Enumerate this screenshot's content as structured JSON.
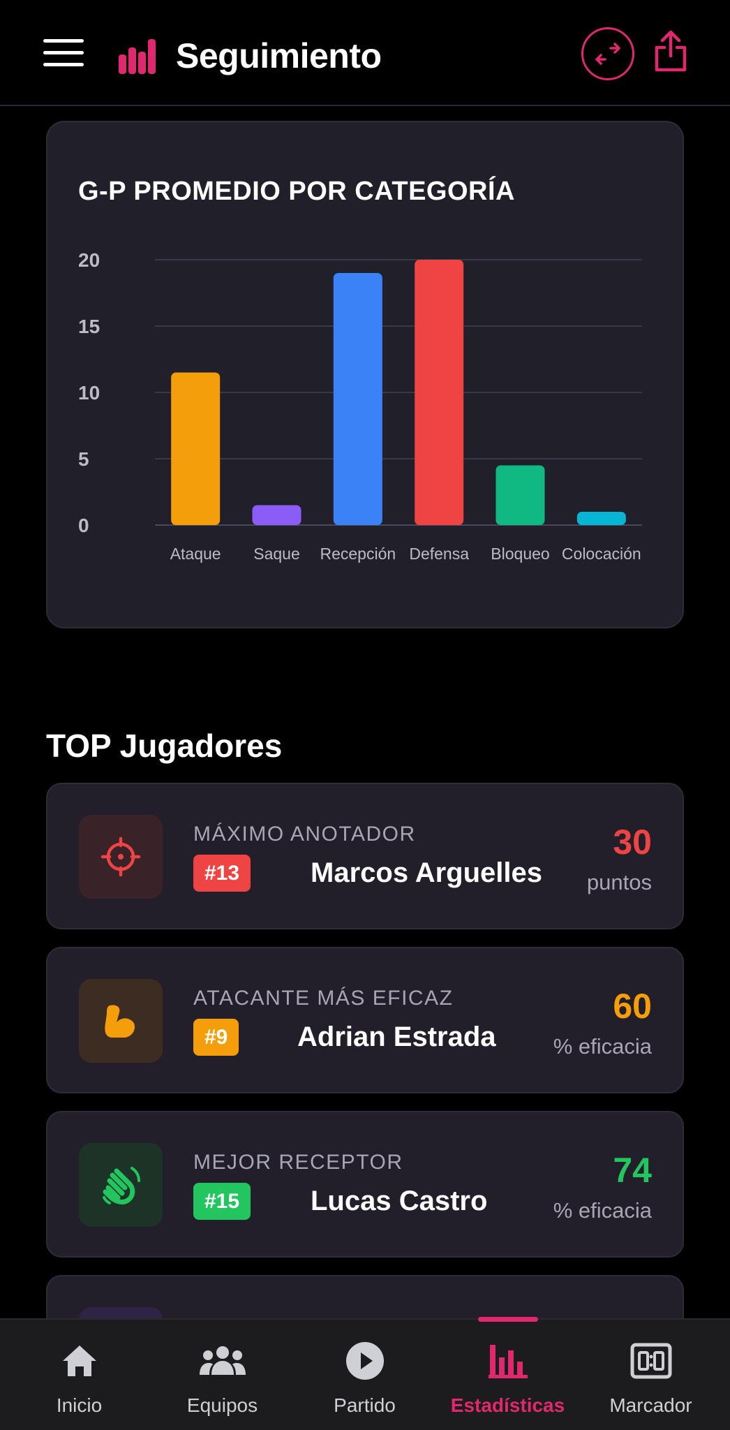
{
  "header": {
    "title": "Seguimiento",
    "accent": "#e0286e"
  },
  "chart_data": {
    "type": "bar",
    "title": "G-P PROMEDIO POR CATEGORÍA",
    "categories": [
      "Ataque",
      "Saque",
      "Recepción",
      "Defensa",
      "Bloqueo",
      "Colocación"
    ],
    "values": [
      11.5,
      1.5,
      19,
      20,
      4.5,
      1
    ],
    "colors": [
      "#f59e0b",
      "#8b5cf6",
      "#3b82f6",
      "#ef4444",
      "#10b981",
      "#06b6d4"
    ],
    "yticks": [
      0,
      5,
      10,
      15,
      20
    ],
    "ylim": [
      0,
      20
    ],
    "grid": true
  },
  "top_players": {
    "title": "TOP Jugadores",
    "items": [
      {
        "label": "MÁXIMO ANOTADOR",
        "number": "#13",
        "name": "Marcos Arguelles",
        "value": "30",
        "unit": "puntos",
        "color": "#ef4444",
        "icon": "target-icon"
      },
      {
        "label": "ATACANTE MÁS EFICAZ",
        "number": "#9",
        "name": "Adrian Estrada",
        "value": "60",
        "unit": "% eficacia",
        "color": "#f59e0b",
        "icon": "flexed-arm-icon"
      },
      {
        "label": "MEJOR RECEPTOR",
        "number": "#15",
        "name": "Lucas Castro",
        "value": "74",
        "unit": "% eficacia",
        "color": "#22c55e",
        "icon": "waving-hands-icon"
      }
    ]
  },
  "bottom_nav": {
    "items": [
      {
        "label": "Inicio",
        "icon": "home-icon"
      },
      {
        "label": "Equipos",
        "icon": "group-icon"
      },
      {
        "label": "Partido",
        "icon": "play-icon"
      },
      {
        "label": "Estadísticas",
        "icon": "bar-chart-icon",
        "active": true
      },
      {
        "label": "Marcador",
        "icon": "scoreboard-icon"
      }
    ]
  }
}
